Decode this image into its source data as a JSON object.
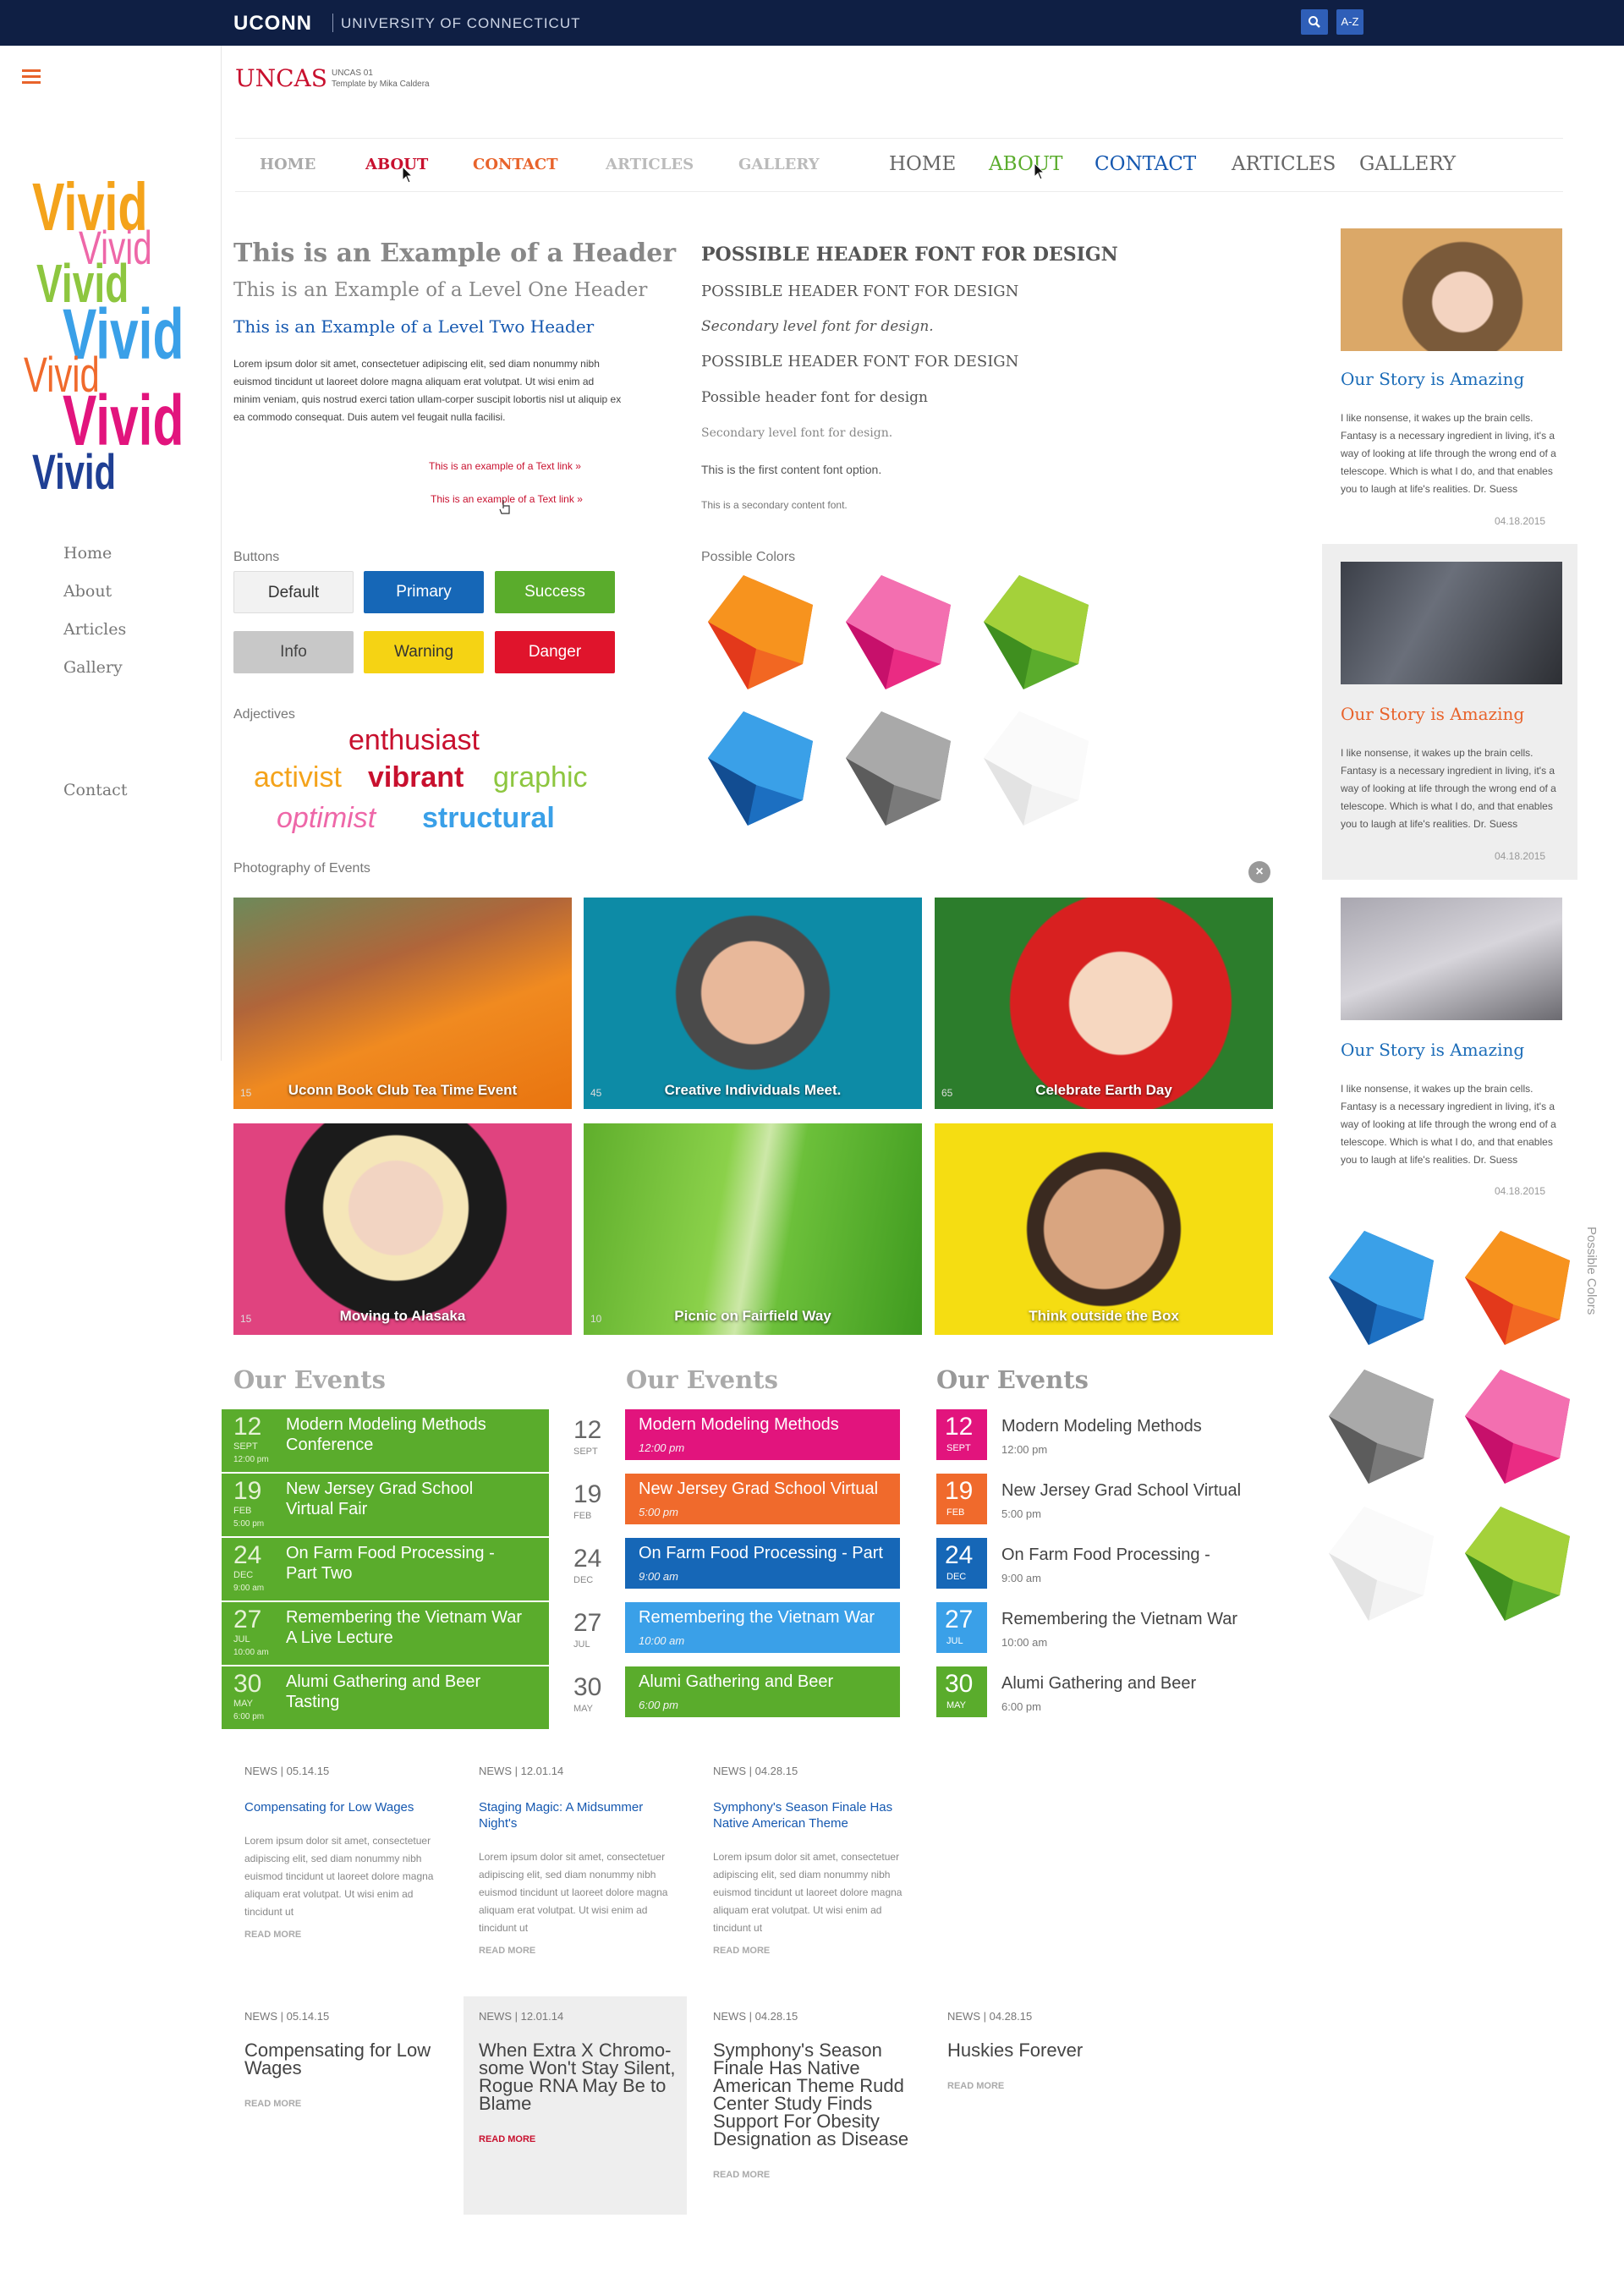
{
  "topbar": {
    "logo": "UCONN",
    "university": "UNIVERSITY OF CONNECTICUT",
    "search_icon": "search-icon",
    "az_label": "A-Z"
  },
  "brand": {
    "name": "UNCAS",
    "code": "UNCAS 01",
    "byline": "Template by Mika Caldera"
  },
  "vivid": {
    "word": "Vivid",
    "colors": [
      "#f4a31b",
      "#ee67a8",
      "#8dc63f",
      "#3aa0e8",
      "#f06a2c",
      "#e2147d",
      "#1f3f94"
    ]
  },
  "rail_nav": [
    "Home",
    "About",
    "Articles",
    "Gallery"
  ],
  "rail_contact": "Contact",
  "nav_a": {
    "items": [
      "HOME",
      "ABOUT",
      "CONTACT",
      "ARTICLES",
      "GALLERY"
    ]
  },
  "nav_b": {
    "items": [
      "HOME",
      "ABOUT",
      "CONTACT",
      "ARTICLES",
      "GALLERY"
    ]
  },
  "typo": {
    "h_main": "This is an Example of a Header",
    "h_one": "This is an Example of a Level One Header",
    "h_two": "This is an Example of a Level Two Header",
    "body": "Lorem ipsum dolor sit amet, consectetuer adipiscing elit, sed diam nonummy nibh euismod tincidunt ut laoreet dolore magna aliquam erat volutpat. Ut wisi enim ad minim veniam, quis nostrud exerci tation ullam-corper suscipit lobortis nisl ut aliquip ex ea commodo consequat. Duis autem vel feugait nulla facilisi.",
    "link1": "This is an example of a Text link »",
    "link2": "This is an example of a Text link »"
  },
  "fonts": {
    "f1": "POSSIBLE HEADER FONT FOR DESIGN",
    "f2": "POSSIBLE HEADER FONT FOR DESIGN",
    "f3": "Secondary level font for design.",
    "f4": "POSSIBLE HEADER FONT FOR DESIGN",
    "f5": "Possible header font for design",
    "f6": "Secondary level font for design.",
    "f7": "This is the first content font option.",
    "f8": "This is a secondary content font."
  },
  "buttons": {
    "label": "Buttons",
    "default": "Default",
    "primary": "Primary",
    "success": "Success",
    "info": "Info",
    "warning": "Warning",
    "danger": "Danger"
  },
  "colors_label": "Possible Colors",
  "colors": {
    "orange": "#f7931e",
    "pink": "#ee4c9c",
    "green": "#8dc63f",
    "blue": "#2f8fe0",
    "gray": "#8c8c8c",
    "white": "#eeeeee"
  },
  "adjectives": {
    "label": "Adjectives",
    "words": [
      "enthusiast",
      "activist",
      "vibrant",
      "graphic",
      "optimist",
      "structural"
    ]
  },
  "photos": {
    "label": "Photography of Events",
    "items": [
      {
        "caption": "Uconn Book Club Tea Time Event",
        "count": "15"
      },
      {
        "caption": "Creative Individuals Meet.",
        "count": "45"
      },
      {
        "caption": "Celebrate Earth Day",
        "count": "65"
      },
      {
        "caption": "Moving to Alasaka",
        "count": "15"
      },
      {
        "caption": "Picnic on Fairfield Way",
        "count": "10"
      },
      {
        "caption": "Think outside the Box",
        "count": ""
      }
    ]
  },
  "events": {
    "heading": "Our Events",
    "items": [
      {
        "day": "12",
        "mon": "SEPT",
        "time": "12:00 pm",
        "name1": "Modern Modeling Methods Conference",
        "name2": "Modern Modeling Methods",
        "name3": "Modern Modeling Methods"
      },
      {
        "day": "19",
        "mon": "FEB",
        "time": "5:00 pm",
        "name1": "New Jersey Grad School Virtual Fair",
        "name2": "New Jersey Grad School Virtual",
        "name3": "New Jersey Grad School Virtual"
      },
      {
        "day": "24",
        "mon": "DEC",
        "time": "9:00 am",
        "name1": "On Farm Food Processing - Part Two",
        "name2": "On Farm Food Processing - Part",
        "name3": "On Farm Food Processing -"
      },
      {
        "day": "27",
        "mon": "JUL",
        "time": "10:00 am",
        "name1": "Remembering the Vietnam War A Live Lecture",
        "name2": "Remembering the Vietnam War",
        "name3": "Remembering the Vietnam War"
      },
      {
        "day": "30",
        "mon": "MAY",
        "time": "6:00 pm",
        "name1": "Alumi Gathering and Beer Tasting",
        "name2": "Alumi Gathering and Beer",
        "name3": "Alumi Gathering and Beer"
      }
    ],
    "col2_colors": [
      "#e2147d",
      "#f06a2c",
      "#1667b7",
      "#3aa0e8",
      "#5aac2c"
    ],
    "col3_colors": [
      "#e2147d",
      "#f06a2c",
      "#1667b7",
      "#3aa0e8",
      "#5aac2c"
    ]
  },
  "news1": [
    {
      "label": "NEWS | 05.14.15",
      "title": "Compensating for Low Wages",
      "read": "READ MORE"
    },
    {
      "label": "NEWS | 12.01.14",
      "title": "Staging Magic: A Midsummer Night's",
      "read": "READ MORE"
    },
    {
      "label": "NEWS | 04.28.15",
      "title": "Symphony's Season Finale Has Native American Theme",
      "read": "READ MORE"
    }
  ],
  "news_body": "Lorem ipsum dolor sit amet, consectetuer adipiscing elit, sed diam nonummy nibh euismod tincidunt ut laoreet dolore magna aliquam erat volutpat. Ut wisi enim ad tincidunt ut",
  "news2": [
    {
      "label": "NEWS | 05.14.15",
      "title": "Compensating for Low Wages",
      "read": "READ MORE"
    },
    {
      "label": "NEWS | 12.01.14",
      "title": "When Extra X Chromo-some Won't Stay Silent, Rogue RNA May Be to Blame",
      "read": "READ MORE"
    },
    {
      "label": "NEWS | 04.28.15",
      "title": "Symphony's Season Finale Has Native American Theme Rudd Center Study Finds Support For Obesity Designation as Disease",
      "read": "READ MORE"
    },
    {
      "label": "NEWS | 04.28.15",
      "title": "Huskies Forever",
      "read": "READ MORE"
    }
  ],
  "sidebar": {
    "stories": [
      {
        "title": "Our Story is Amazing",
        "body": "I like nonsense, it wakes up the brain cells. Fantasy is a necessary ingredient in living, it's a way of looking at life through the wrong end of a telescope. Which is what I do, and that enables you to laugh at life's realities. Dr. Suess",
        "date": "04.18.2015"
      },
      {
        "title": "Our Story is Amazing",
        "body": "I like nonsense, it wakes up the brain cells. Fantasy is a necessary ingredient in living, it's a way of looking at life through the wrong end of a telescope. Which is what I do, and that enables you to laugh at life's realities. Dr. Suess",
        "date": "04.18.2015"
      },
      {
        "title": "Our Story is Amazing",
        "body": "I like nonsense, it wakes up the brain cells. Fantasy is a necessary ingredient in living, it's a way of looking at life through the wrong end of a telescope. Which is what I do, and that enables you to laugh at life's realities. Dr. Suess",
        "date": "04.18.2015"
      }
    ],
    "colors_label": "Possible Colors"
  }
}
